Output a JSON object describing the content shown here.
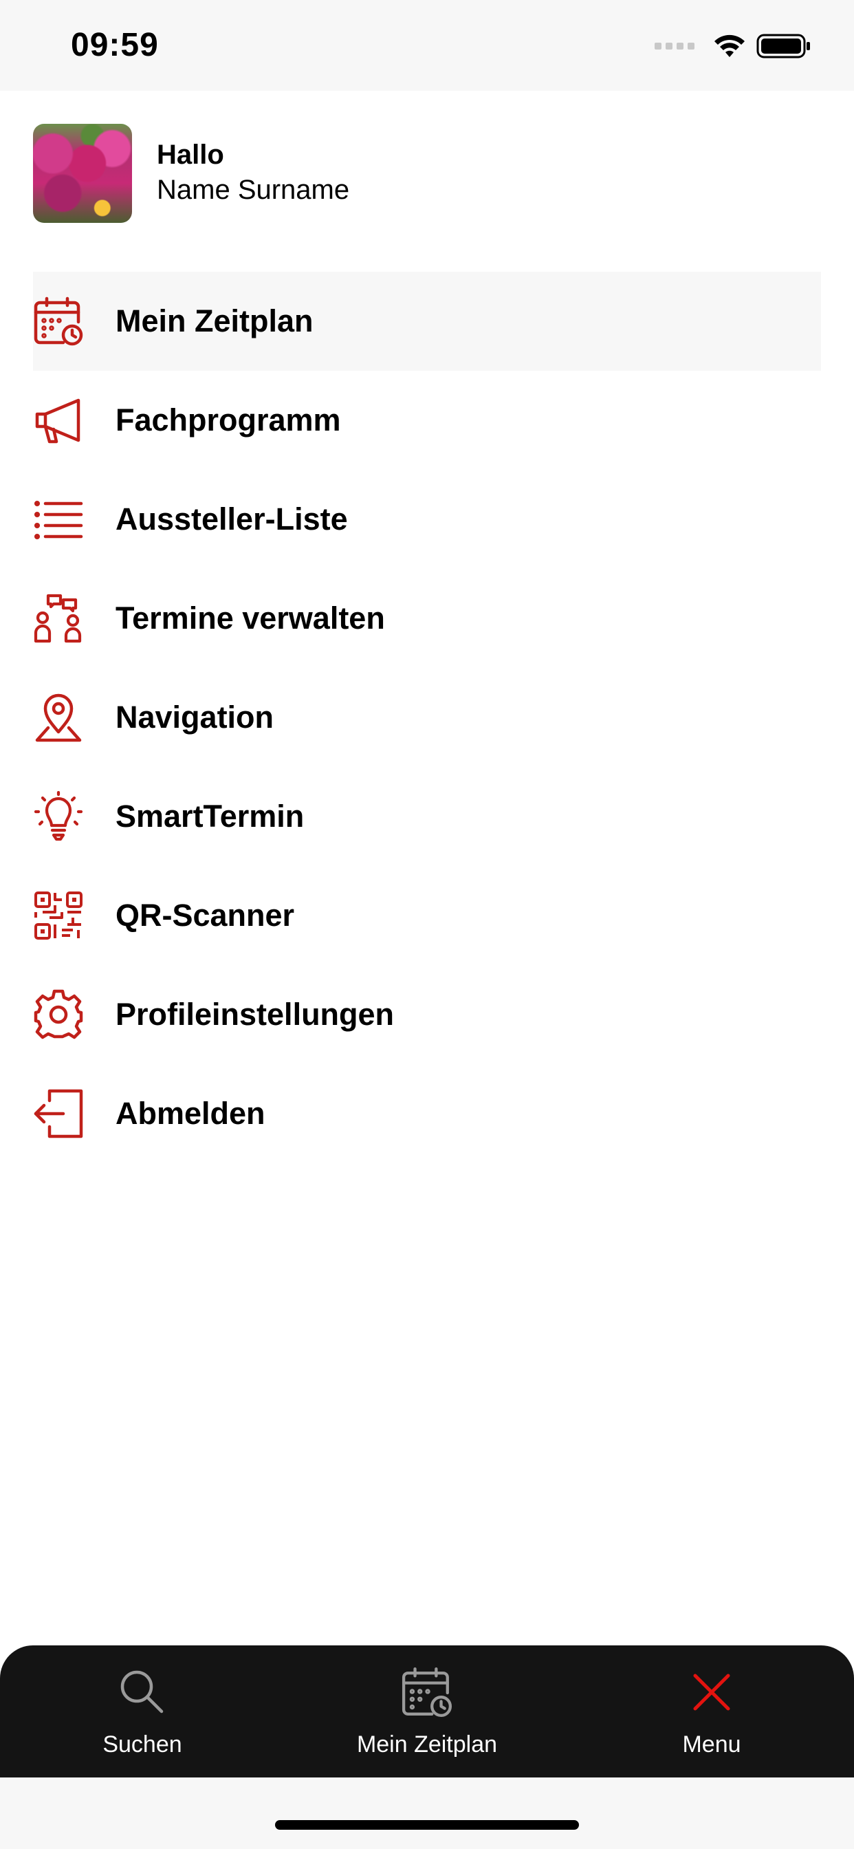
{
  "status_bar": {
    "time": "09:59"
  },
  "profile": {
    "greeting": "Hallo",
    "name": "Name Surname"
  },
  "colors": {
    "accent": "#c0201a",
    "tab_bar_bg": "#141414",
    "active_row_bg": "#f7f7f7",
    "tab_icon_inactive": "#9a9a9a",
    "tab_icon_active": "#e3130f"
  },
  "menu": {
    "items": [
      {
        "label": "Mein Zeitplan",
        "icon": "calendar-clock-icon",
        "active": true
      },
      {
        "label": "Fachprogramm",
        "icon": "megaphone-icon"
      },
      {
        "label": "Aussteller-Liste",
        "icon": "list-icon"
      },
      {
        "label": "Termine verwalten",
        "icon": "meeting-people-icon"
      },
      {
        "label": "Navigation",
        "icon": "map-pin-icon"
      },
      {
        "label": "SmartTermin",
        "icon": "lightbulb-icon"
      },
      {
        "label": "QR-Scanner",
        "icon": "qr-code-icon"
      },
      {
        "label": "Profileinstellungen",
        "icon": "gear-icon"
      },
      {
        "label": "Abmelden",
        "icon": "logout-icon"
      }
    ]
  },
  "tab_bar": {
    "tabs": [
      {
        "label": "Suchen",
        "icon": "search-icon"
      },
      {
        "label": "Mein Zeitplan",
        "icon": "calendar-clock-icon"
      },
      {
        "label": "Menu",
        "icon": "close-icon"
      }
    ]
  }
}
